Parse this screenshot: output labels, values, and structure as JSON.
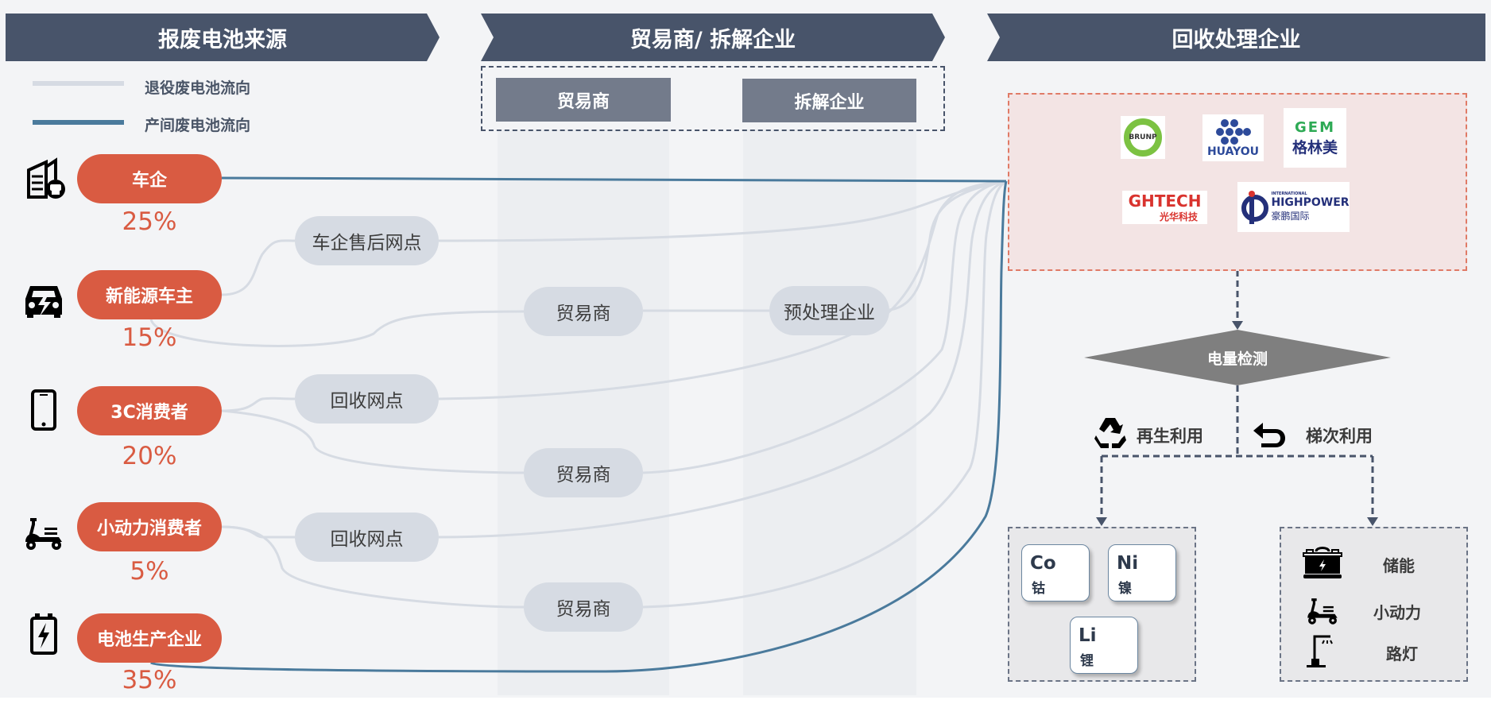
{
  "headers": {
    "source": "报废电池来源",
    "middle": "贸易商/ 拆解企业",
    "recycler": "回收处理企业"
  },
  "legend": [
    {
      "label": "退役废电池流向",
      "color": "#d6dbe3"
    },
    {
      "label": "产间废电池流向",
      "color": "#4a7a9c"
    }
  ],
  "middle_subheaders": [
    "贸易商",
    "拆解企业"
  ],
  "sources": [
    {
      "label": "车企",
      "percent": "25%",
      "icon": "building-cars-icon"
    },
    {
      "label": "新能源车主",
      "percent": "15%",
      "icon": "electric-car-icon"
    },
    {
      "label": "3C消费者",
      "percent": "20%",
      "icon": "smartphone-icon"
    },
    {
      "label": "小动力消费者",
      "percent": "5%",
      "icon": "scooter-icon"
    },
    {
      "label": "电池生产企业",
      "percent": "35%",
      "icon": "battery-bolt-icon"
    }
  ],
  "intermediaries": {
    "aftersales": "车企售后网点",
    "recycle_point_1": "回收网点",
    "recycle_point_2": "回收网点",
    "trader_1": "贸易商",
    "trader_2": "贸易商",
    "trader_3": "贸易商",
    "preprocessor": "预处理企业"
  },
  "recyclers": {
    "logos": [
      {
        "name": "BRUNP",
        "text": "BRUNP"
      },
      {
        "name": "HUAYOU",
        "text": "HUAYOU"
      },
      {
        "name": "GEM",
        "text_en": "GEM",
        "text_cn": "格林美"
      },
      {
        "name": "GHTECH",
        "text_en": "GHTECH",
        "text_cn": "光华科技"
      },
      {
        "name": "HIGHPOWER",
        "text_small": "INTERNATIONAL",
        "text_en": "HIGHPOWER",
        "text_cn": "豪鹏国际"
      }
    ]
  },
  "detection": "电量检测",
  "branches": {
    "recycle": {
      "label": "再生利用",
      "icon": "recycle-icon"
    },
    "cascade": {
      "label": "梯次利用",
      "icon": "undo-arrow-icon"
    }
  },
  "elements": [
    {
      "symbol": "Co",
      "name": "钴"
    },
    {
      "symbol": "Ni",
      "name": "镍"
    },
    {
      "symbol": "Li",
      "name": "锂"
    }
  ],
  "cascade_uses": [
    {
      "label": "储能",
      "icon": "energy-storage-battery-icon"
    },
    {
      "label": "小动力",
      "icon": "scooter-icon"
    },
    {
      "label": "路灯",
      "icon": "street-light-icon"
    }
  ],
  "colors": {
    "header": "#48546a",
    "source_pill": "#d95b42",
    "retired_flow": "#d6dbe3",
    "production_flow": "#4a7a9c",
    "recycler_box": "#f3e4e4",
    "recycler_border": "#e07a66",
    "diamond": "#7f7f7f"
  }
}
